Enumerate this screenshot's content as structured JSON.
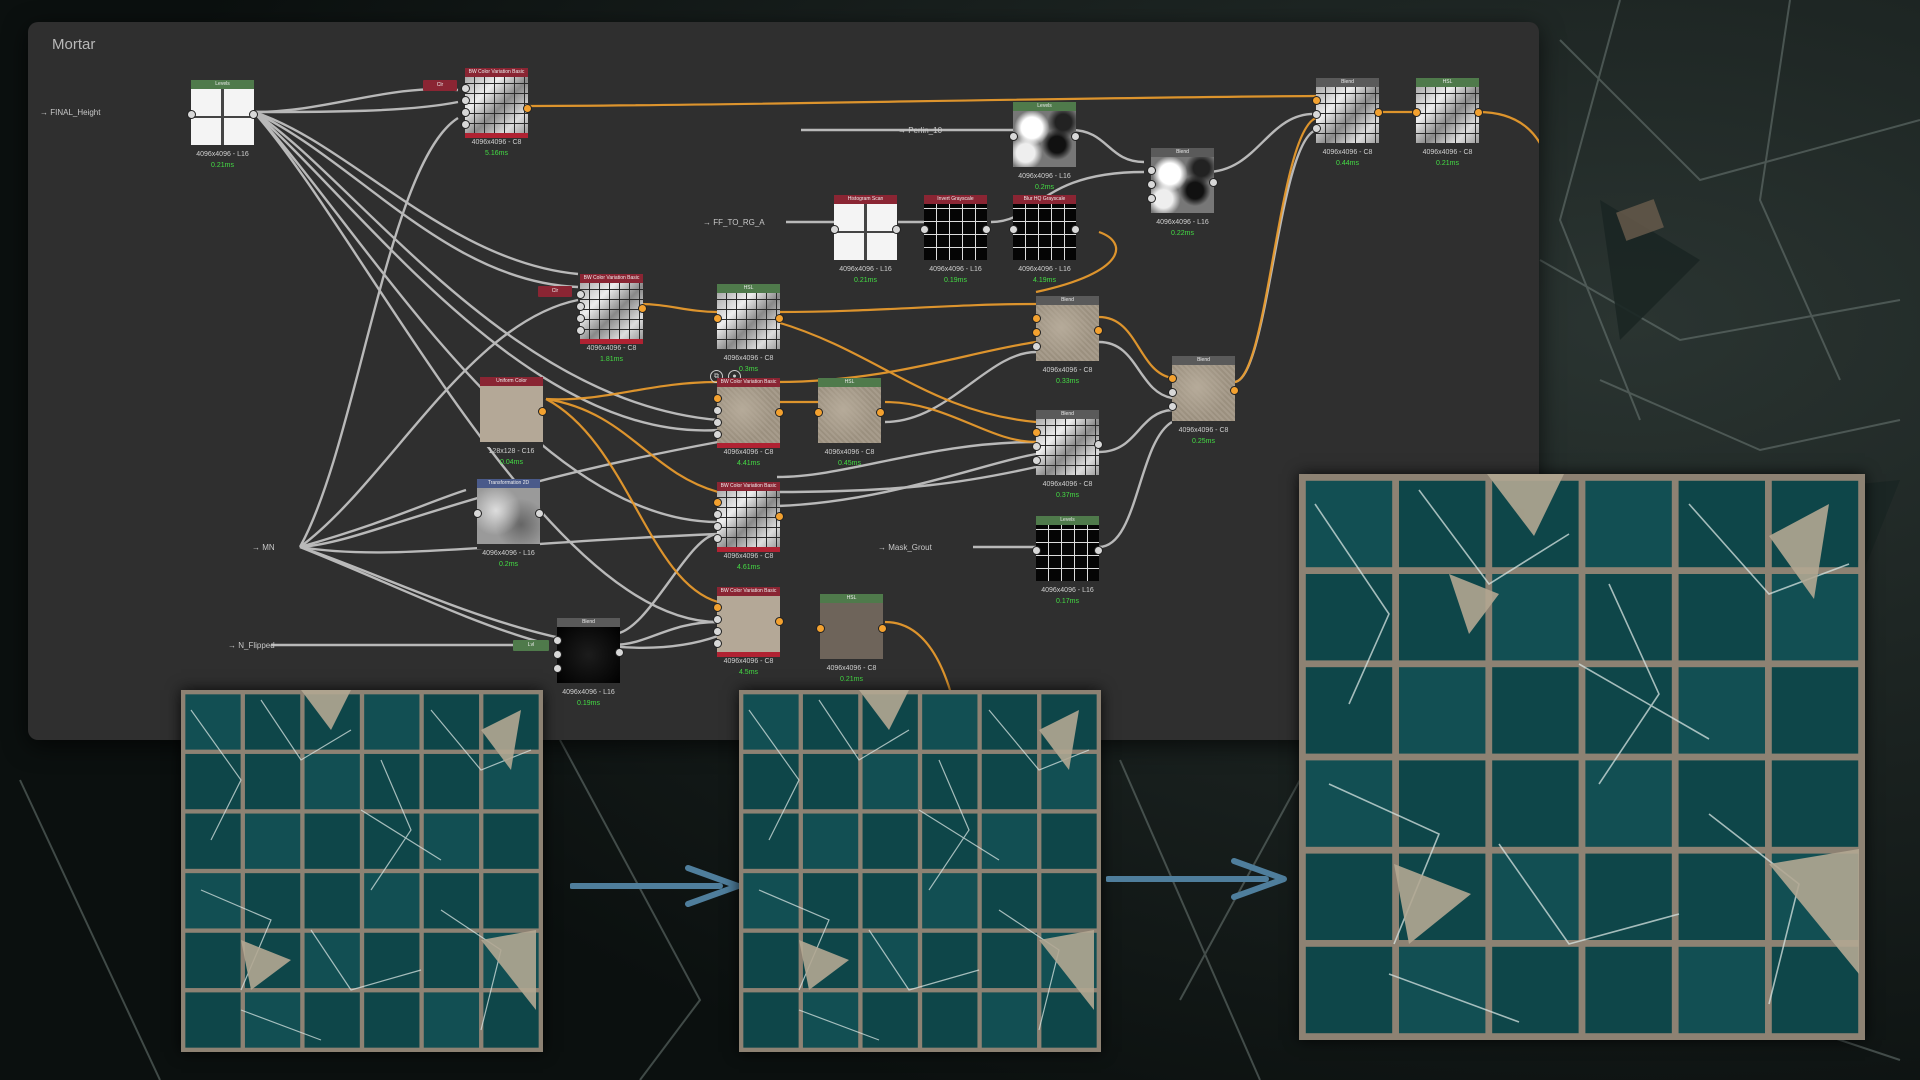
{
  "panel": {
    "title": "Mortar"
  },
  "colors": {
    "teal": "#0f4a4e",
    "grout": "#8d8273",
    "wire_gray": "#c8c8c8",
    "wire_orange": "#e79a2d",
    "time_green": "#44dd44",
    "arrow_blue": "#4f7e9c"
  },
  "inputs": {
    "final_height": "→ FINAL_Height",
    "perlin": "→ Perlin_10",
    "ff_to_rg": "→ FF_TO_RG_A",
    "mn": "→ MN",
    "mask_grout": "→ Mask_Grout",
    "n_flipped": "→ N_Flipped"
  },
  "badges": {
    "c1": "Clr",
    "c2": "Clr",
    "lvl": "Lvl"
  },
  "tool_icons": [
    "copy-icon",
    "record-icon"
  ],
  "nodes": {
    "n1": {
      "title": "Levels",
      "info": "4096x4096 - L16",
      "time": "0.21ms"
    },
    "n2": {
      "title": "BW Color Variation Basic",
      "info": "4096x4096 - C8",
      "time": "5.16ms"
    },
    "n3": {
      "title": "Levels",
      "info": "4096x4096 - L16",
      "time": "0.2ms"
    },
    "n4": {
      "title": "Histogram Scan",
      "info": "4096x4096 - L16",
      "time": "0.21ms"
    },
    "n5": {
      "title": "Invert Grayscale",
      "info": "4096x4096 - L16",
      "time": "0.19ms"
    },
    "n6": {
      "title": "Blur HQ Grayscale",
      "info": "4096x4096 - L16",
      "time": "4.19ms"
    },
    "n7": {
      "title": "Blend",
      "info": "4096x4096 - L16",
      "time": "0.22ms"
    },
    "n8": {
      "title": "Blend",
      "info": "4096x4096 - C8",
      "time": "0.44ms"
    },
    "n9": {
      "title": "HSL",
      "info": "4096x4096 - C8",
      "time": "0.21ms"
    },
    "n10": {
      "title": "BW Color Variation Basic",
      "info": "4096x4096 - C8",
      "time": "1.81ms"
    },
    "n11": {
      "title": "HSL",
      "info": "4096x4096 - C8",
      "time": "0.3ms"
    },
    "n12": {
      "title": "Blend",
      "info": "4096x4096 - C8",
      "time": "0.33ms"
    },
    "n13": {
      "title": "Uniform Color",
      "info": "128x128 - C16",
      "time": "0.04ms"
    },
    "n14": {
      "title": "BW Color Variation Basic",
      "info": "4096x4096 - C8",
      "time": "4.41ms"
    },
    "n15": {
      "title": "HSL",
      "info": "4096x4096 - C8",
      "time": "0.45ms"
    },
    "n16": {
      "title": "Blend",
      "info": "4096x4096 - C8",
      "time": "0.37ms"
    },
    "n17": {
      "title": "Blend",
      "info": "4096x4096 - C8",
      "time": "0.25ms"
    },
    "n18": {
      "title": "Transformation 2D",
      "info": "4096x4096 - L16",
      "time": "0.2ms"
    },
    "n19": {
      "title": "BW Color Variation Basic",
      "info": "4096x4096 - C8",
      "time": "4.61ms"
    },
    "n20": {
      "title": "Levels",
      "info": "4096x4096 - L16",
      "time": "0.17ms"
    },
    "n21": {
      "title": "Blend",
      "info": "4096x4096 - L16",
      "time": "0.19ms"
    },
    "n22": {
      "title": "BW Color Variation Basic",
      "info": "4096x4096 - C8",
      "time": "4.5ms"
    },
    "n23": {
      "title": "HSL",
      "info": "4096x4096 - C8",
      "time": "0.21ms"
    }
  },
  "previews": [
    {
      "name": "preview-before",
      "caption": ""
    },
    {
      "name": "preview-middle",
      "caption": ""
    },
    {
      "name": "preview-after",
      "caption": ""
    }
  ]
}
